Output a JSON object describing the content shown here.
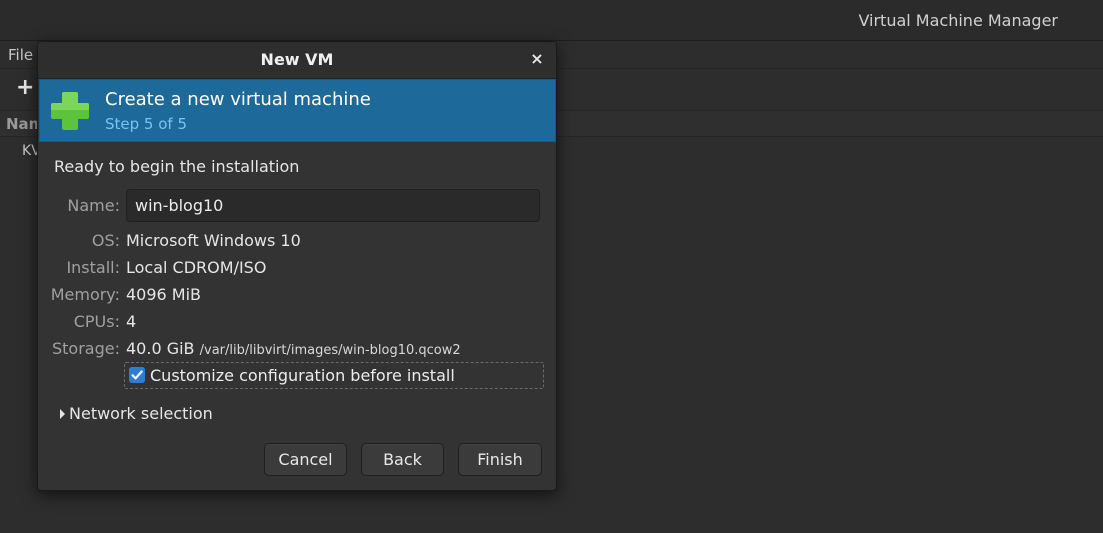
{
  "main_window": {
    "title": "Virtual Machine Manager",
    "menu": {
      "file": "File"
    },
    "toolbar": {
      "new_glyph": "+"
    },
    "list": {
      "column_name": "Nam",
      "row_kvm": "KV"
    }
  },
  "dialog": {
    "title": "New VM",
    "close_glyph": "×",
    "banner": {
      "title": "Create a new virtual machine",
      "subtitle": "Step 5 of 5",
      "icon": "plus-icon"
    },
    "heading": "Ready to begin the installation",
    "fields": {
      "name": {
        "label": "Name:",
        "value": "win-blog10"
      },
      "os": {
        "label": "OS:",
        "value": "Microsoft Windows 10"
      },
      "install": {
        "label": "Install:",
        "value": "Local CDROM/ISO"
      },
      "memory": {
        "label": "Memory:",
        "value": "4096 MiB"
      },
      "cpus": {
        "label": "CPUs:",
        "value": "4"
      },
      "storage": {
        "label": "Storage:",
        "size": "40.0 GiB",
        "path": "/var/lib/libvirt/images/win-blog10.qcow2"
      }
    },
    "customize": {
      "label": "Customize configuration before install",
      "checked": true
    },
    "network_expander": "Network selection",
    "buttons": {
      "cancel": "Cancel",
      "back": "Back",
      "finish": "Finish"
    }
  },
  "colors": {
    "banner_bg": "#1d6a9a",
    "banner_subtitle": "#7cc3f0",
    "plus_green": "#5cc33a",
    "checkbox_blue": "#2a7fd4"
  }
}
